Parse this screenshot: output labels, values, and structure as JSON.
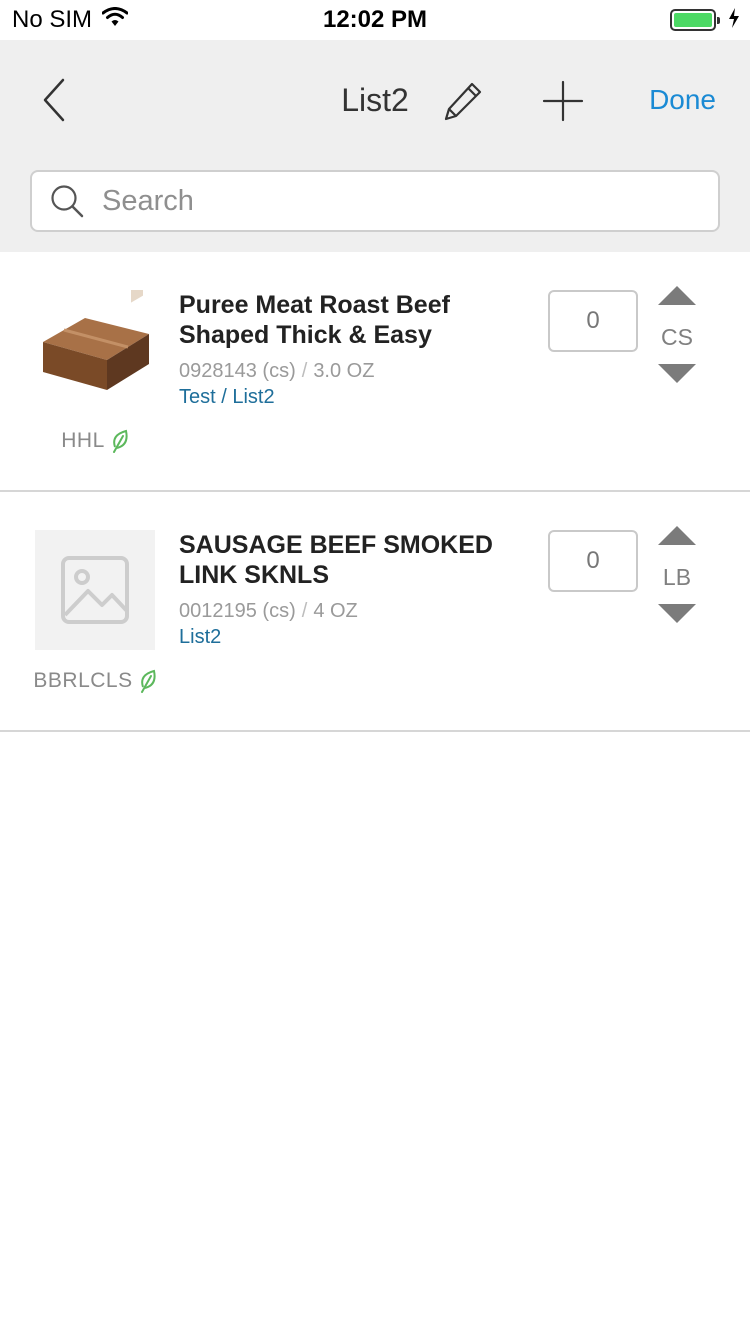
{
  "status_bar": {
    "carrier": "No SIM",
    "time": "12:02 PM"
  },
  "nav": {
    "title": "List2",
    "done_label": "Done"
  },
  "search": {
    "placeholder": "Search",
    "value": ""
  },
  "items": [
    {
      "title": "Puree Meat Roast Beef Shaped Thick & Easy",
      "code": "0928143 (cs)",
      "separator": "/",
      "size": "3.0 OZ",
      "lists": "Test / List2",
      "brand": "HHL",
      "quantity": "0",
      "unit": "CS"
    },
    {
      "title": "SAUSAGE BEEF SMOKED LINK SKNLS",
      "code": "0012195 (cs)",
      "separator": "/",
      "size": "4 OZ",
      "lists": "List2",
      "brand": "BBRLCLS",
      "quantity": "0",
      "unit": "LB"
    }
  ],
  "colors": {
    "accent": "#1a8ad4",
    "list_link": "#1e6e9a",
    "leaf": "#5cb85c",
    "battery": "#4cd964"
  }
}
